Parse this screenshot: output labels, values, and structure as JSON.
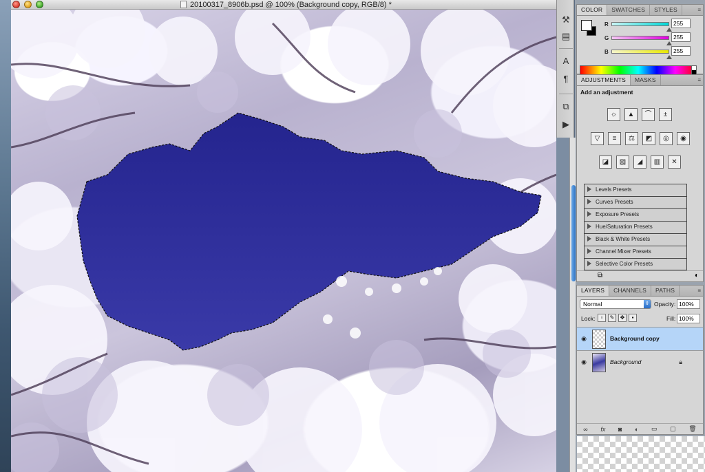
{
  "window": {
    "title": "20100317_8906b.psd @ 100% (Background copy, RGB/8) *"
  },
  "tools_panel": {
    "icons": [
      "clone-source-icon",
      "brush-presets-icon",
      "character-icon",
      "paragraph-icon",
      "tool-presets-icon",
      "actions-icon"
    ]
  },
  "color_panel": {
    "tabs": [
      "COLOR",
      "SWATCHES",
      "STYLES"
    ],
    "channels": [
      {
        "label": "R",
        "value": "255",
        "color": "#00d8d8"
      },
      {
        "label": "G",
        "value": "255",
        "color": "#e000e0"
      },
      {
        "label": "B",
        "value": "255",
        "color": "#e8e800"
      }
    ],
    "foreground": "#ffffff",
    "background": "#000000"
  },
  "adjustments_panel": {
    "tabs": [
      "ADJUSTMENTS",
      "MASKS"
    ],
    "heading": "Add an adjustment",
    "presets": [
      "Levels Presets",
      "Curves Presets",
      "Exposure Presets",
      "Hue/Saturation Presets",
      "Black & White Presets",
      "Channel Mixer Presets",
      "Selective Color Presets"
    ]
  },
  "layers_panel": {
    "tabs": [
      "LAYERS",
      "CHANNELS",
      "PATHS"
    ],
    "blend_mode": "Normal",
    "opacity_label": "Opacity:",
    "opacity_value": "100%",
    "lock_label": "Lock:",
    "fill_label": "Fill:",
    "fill_value": "100%",
    "layers": [
      {
        "name": "Background copy",
        "selected": true
      },
      {
        "name": "Background",
        "selected": false,
        "locked": true
      }
    ],
    "footer_icons": [
      "link-layers-icon",
      "fx-icon",
      "add-mask-icon",
      "new-adjustment-icon",
      "new-group-icon",
      "new-layer-icon",
      "trash-icon"
    ]
  },
  "colors": {
    "sky": "#2a2a9a",
    "selection_highlight": "#b5d5f8"
  }
}
